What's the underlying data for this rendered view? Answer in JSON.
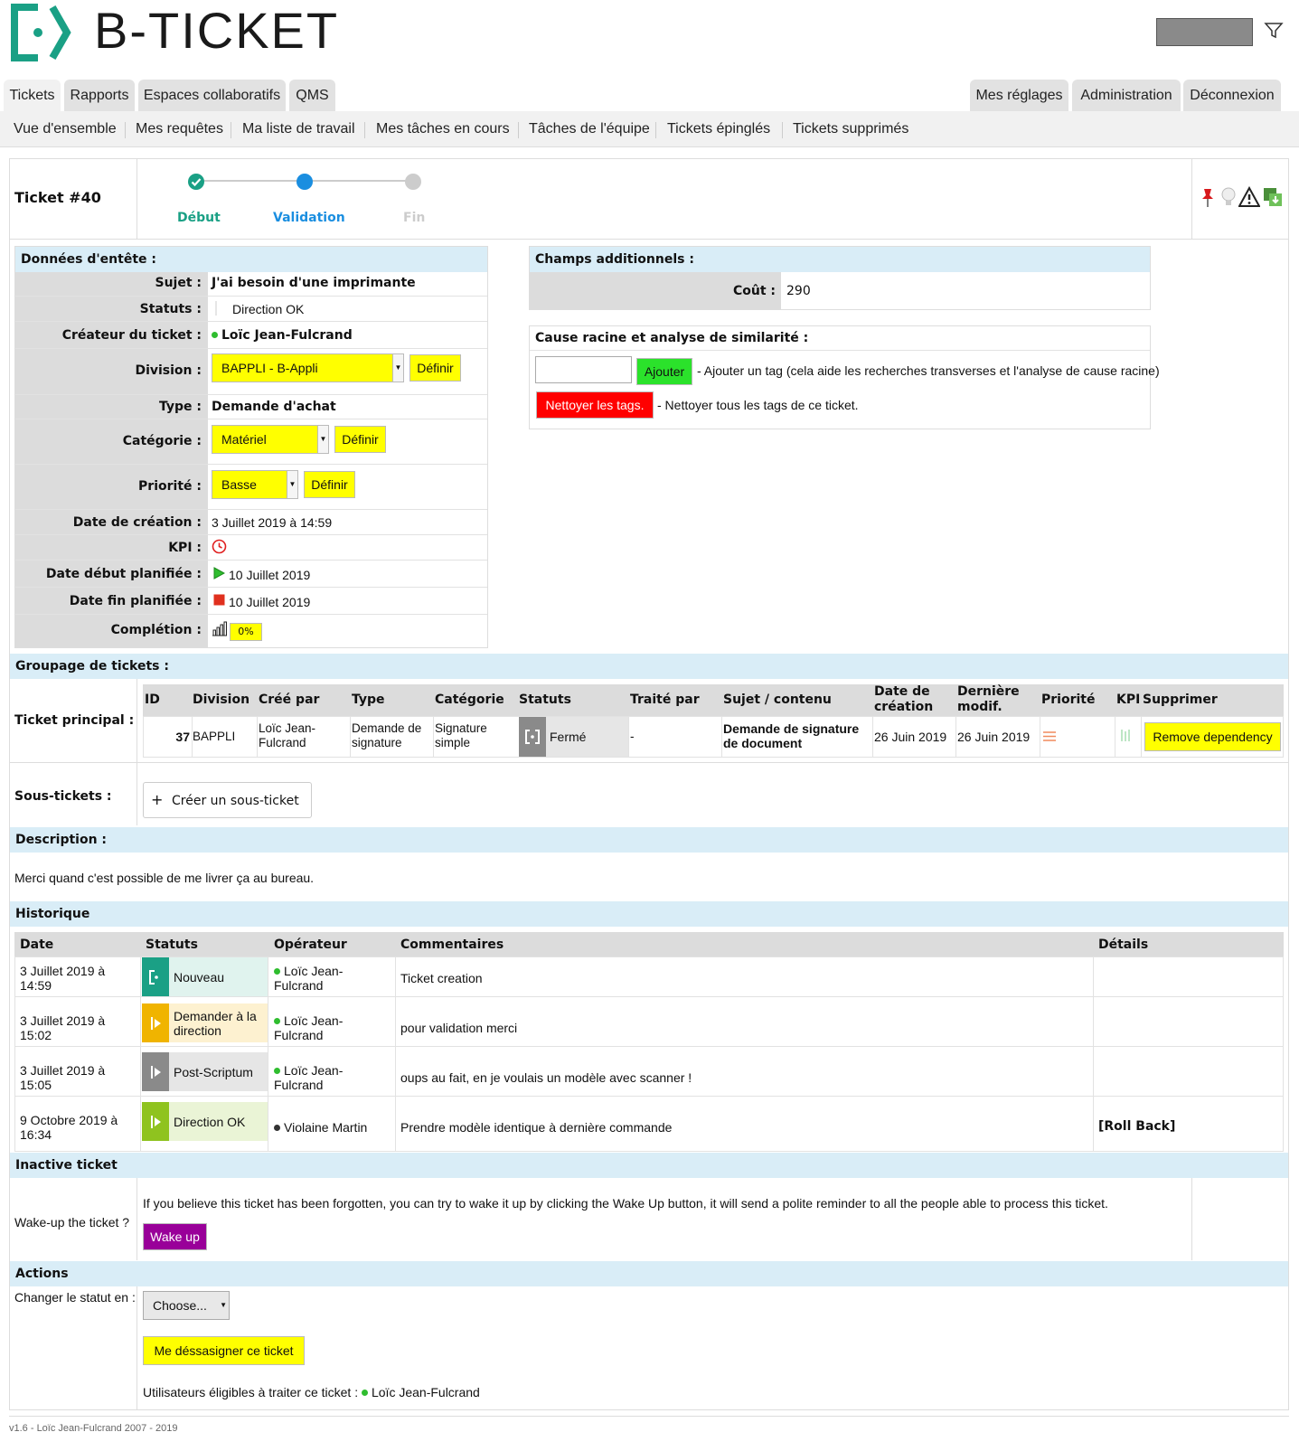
{
  "brand": {
    "name": "B-TICKET"
  },
  "main_tabs": [
    {
      "label": "Tickets"
    },
    {
      "label": "Rapports"
    },
    {
      "label": "Espaces collaboratifs"
    },
    {
      "label": "QMS"
    }
  ],
  "right_tabs": [
    {
      "label": "Mes réglages"
    },
    {
      "label": "Administration"
    },
    {
      "label": "Déconnexion"
    }
  ],
  "subnav": [
    {
      "label": "Vue d'ensemble"
    },
    {
      "label": "Mes requêtes"
    },
    {
      "label": "Ma liste de travail"
    },
    {
      "label": "Mes tâches en cours"
    },
    {
      "label": "Tâches de l'équipe"
    },
    {
      "label": "Tickets épinglés"
    },
    {
      "label": "Tickets supprimés"
    }
  ],
  "ticket": {
    "title": "Ticket #40",
    "steps": [
      {
        "label": "Début"
      },
      {
        "label": "Validation"
      },
      {
        "label": "Fin"
      }
    ]
  },
  "header_data": {
    "title": "Données d'entête :",
    "sujet_label": "Sujet :",
    "sujet": "J'ai besoin d'une imprimante",
    "statuts_label": "Statuts :",
    "statuts": "Direction OK",
    "createur_label": "Créateur du ticket :",
    "createur": "Loïc Jean-Fulcrand",
    "division_label": "Division :",
    "division": "BAPPLI - B-Appli",
    "type_label": "Type :",
    "type": "Demande d'achat",
    "categorie_label": "Catégorie :",
    "categorie": "Matériel",
    "priorite_label": "Priorité :",
    "priorite": "Basse",
    "date_creation_label": "Date de création :",
    "date_creation": "3 Juillet 2019 à 14:59",
    "kpi_label": "KPI :",
    "date_debut_label": "Date début planifiée :",
    "date_debut": "10 Juillet 2019",
    "date_fin_label": "Date fin planifiée :",
    "date_fin": "10 Juillet 2019",
    "completion_label": "Complétion :",
    "completion": "0%",
    "definir": "Définir"
  },
  "additional": {
    "title": "Champs additionnels :",
    "cout_label": "Coût :",
    "cout": "290"
  },
  "root_cause": {
    "title": "Cause racine et analyse de similarité :",
    "add_button": "Ajouter",
    "add_help": "- Ajouter un tag (cela aide les recherches transverses et l'analyse de cause racine)",
    "clean_button": "Nettoyer les tags.",
    "clean_help": "- Nettoyer tous les tags de ce ticket."
  },
  "grouping": {
    "title": "Groupage de tickets :",
    "main_label": "Ticket principal :",
    "columns": [
      "ID",
      "Division",
      "Créé par",
      "Type",
      "Catégorie",
      "Statuts",
      "Traité par",
      "Sujet / contenu",
      "Date de création",
      "Dernière modif.",
      "Priorité",
      "KPI",
      "Supprimer"
    ],
    "row": {
      "id": "37",
      "division": "BAPPLI",
      "cree_par": "Loïc Jean-Fulcrand",
      "type": "Demande de signature",
      "categorie": "Signature simple",
      "statut": "Fermé",
      "traite_par": "-",
      "sujet": "Demande de signature de document",
      "date_creation": "26 Juin 2019",
      "derniere_modif": "26 Juin 2019",
      "remove": "Remove dependency"
    },
    "sub_label": "Sous-tickets :",
    "create_sub": "Créer un sous-ticket"
  },
  "description": {
    "title": "Description :",
    "text": "Merci quand c'est possible de me livrer ça au bureau."
  },
  "history": {
    "title": "Historique",
    "columns": [
      "Date",
      "Statuts",
      "Opérateur",
      "Commentaires",
      "Détails"
    ],
    "rows": [
      {
        "date": "3 Juillet 2019 à 14:59",
        "status": "Nouveau",
        "operator": "Loïc Jean-Fulcrand",
        "comment": "Ticket creation",
        "details": "",
        "color": "#1aa085",
        "bg": "#e0f3ee"
      },
      {
        "date": "3 Juillet 2019 à 15:02",
        "status": "Demander à la direction",
        "operator": "Loïc Jean-Fulcrand",
        "comment": "pour validation merci",
        "details": "",
        "color": "#f0b400",
        "bg": "#fdf1d0"
      },
      {
        "date": "3 Juillet 2019 à 15:05",
        "status": "Post-Scriptum",
        "operator": "Loïc Jean-Fulcrand",
        "comment": "oups au fait, en je voulais un modèle avec scanner !",
        "details": "",
        "color": "#8a8a8a",
        "bg": "#e6e6e6"
      },
      {
        "date": "9 Octobre 2019 à 16:34",
        "status": "Direction OK",
        "operator": "Violaine Martin",
        "comment": "Prendre modèle identique à dernière commande",
        "details": "[Roll Back]",
        "color": "#8fc31f",
        "bg": "#eaf4d6"
      }
    ]
  },
  "inactive": {
    "title": "Inactive ticket",
    "label": "Wake-up the ticket ?",
    "text": "If you believe this ticket has been forgotten, you can try to wake it up by clicking the Wake Up button, it will send a polite reminder to all the people able to process this ticket.",
    "button": "Wake up"
  },
  "actions": {
    "title": "Actions",
    "status_label": "Changer le statut en :",
    "choose": "Choose...",
    "unassign": "Me déssasigner ce ticket",
    "eligible_label": "Utilisateurs éligibles à traiter ce ticket :",
    "eligible_user": "Loïc Jean-Fulcrand"
  },
  "footer": {
    "text": "v1.6 - Loïc Jean-Fulcrand 2007 - 2019"
  }
}
